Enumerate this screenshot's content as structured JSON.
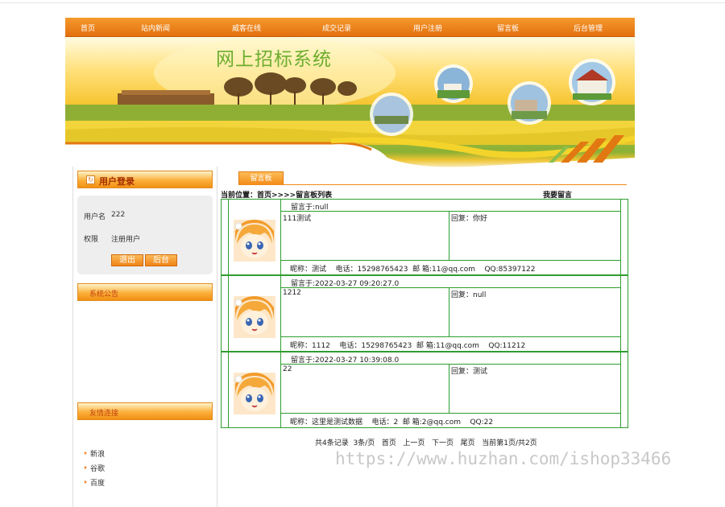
{
  "nav": {
    "items": [
      "首页",
      "站内新闻",
      "威客在线",
      "成交记录",
      "用户注册",
      "留言板",
      "后台管理"
    ]
  },
  "banner": {
    "title": "网上招标系统"
  },
  "login": {
    "title": "用户登录",
    "username_label": "用户名",
    "username_value": "222",
    "role_label": "权限",
    "role_value": "注册用户",
    "logout_label": "退出",
    "admin_label": "后台"
  },
  "announcement": {
    "title": "系统公告"
  },
  "friend_links": {
    "title": "友情连接",
    "items": [
      "新浪",
      "谷歌",
      "百度"
    ]
  },
  "main": {
    "tab_label": "留言板",
    "breadcrumb": "当前位置：首页>>>>留言板列表",
    "write_message": "我要留言"
  },
  "messages": [
    {
      "time": "留言于:null",
      "content": "111测试",
      "reply": "回复：你好",
      "info": "昵称：测试    电话：15298765423  邮 箱:11@qq.com    QQ:85397122"
    },
    {
      "time": "留言于:2022-03-27 09:20:27.0",
      "content": "1212",
      "reply": "回复：null",
      "info": "昵称：1112    电话：15298765423  邮 箱:11@qq.com    QQ:11212"
    },
    {
      "time": "留言于:2022-03-27 10:39:08.0",
      "content": "22",
      "reply": "回复：测试",
      "info": "昵称：这里是测试数据    电话：2  邮 箱:2@qq.com    QQ:22"
    }
  ],
  "pager": {
    "summary": "共4条记录  3条/页",
    "first": "首页",
    "prev": "上一页",
    "next": "下一页",
    "last": "尾页",
    "current": "当前第1页/共2页"
  },
  "watermark": "https://www.huzhan.com/ishop33466",
  "colors": {
    "nav": "#e3700f",
    "accent": "#f28a17",
    "table_border": "#2f9d2f",
    "title_green": "#6cad2e"
  }
}
